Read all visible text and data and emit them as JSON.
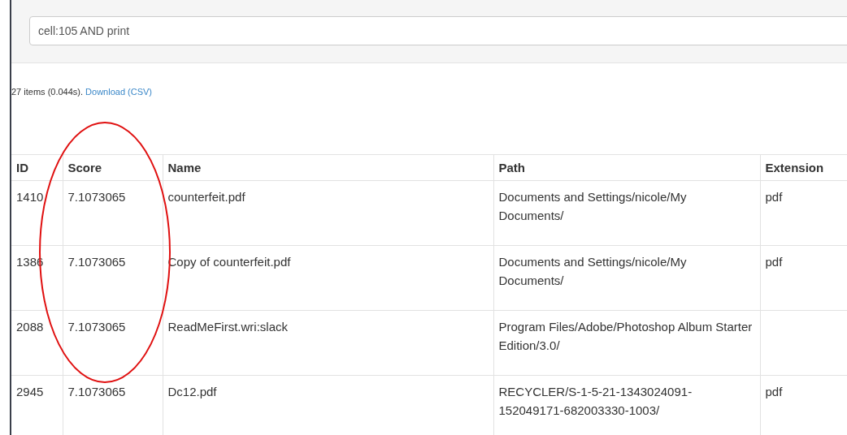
{
  "search": {
    "value": "cell:105 AND print"
  },
  "summary": {
    "count_text": "27 items (0.044s).",
    "download_link": "Download (CSV)"
  },
  "table": {
    "columns": [
      "ID",
      "Score",
      "Name",
      "Path",
      "Extension"
    ],
    "rows": [
      [
        "1410",
        "7.1073065",
        "counterfeit.pdf",
        "Documents and Settings/nicole/My Documents/",
        "pdf"
      ],
      [
        "1386",
        "7.1073065",
        "Copy of counterfeit.pdf",
        "Documents and Settings/nicole/My Documents/",
        "pdf"
      ],
      [
        "2088",
        "7.1073065",
        "ReadMeFirst.wri:slack",
        "Program Files/Adobe/Photoshop Album Starter Edition/3.0/",
        ""
      ],
      [
        "2945",
        "7.1073065",
        "Dc12.pdf",
        "RECYCLER/S-1-5-21-1343024091-152049171-682003330-1003/",
        "pdf"
      ]
    ]
  }
}
